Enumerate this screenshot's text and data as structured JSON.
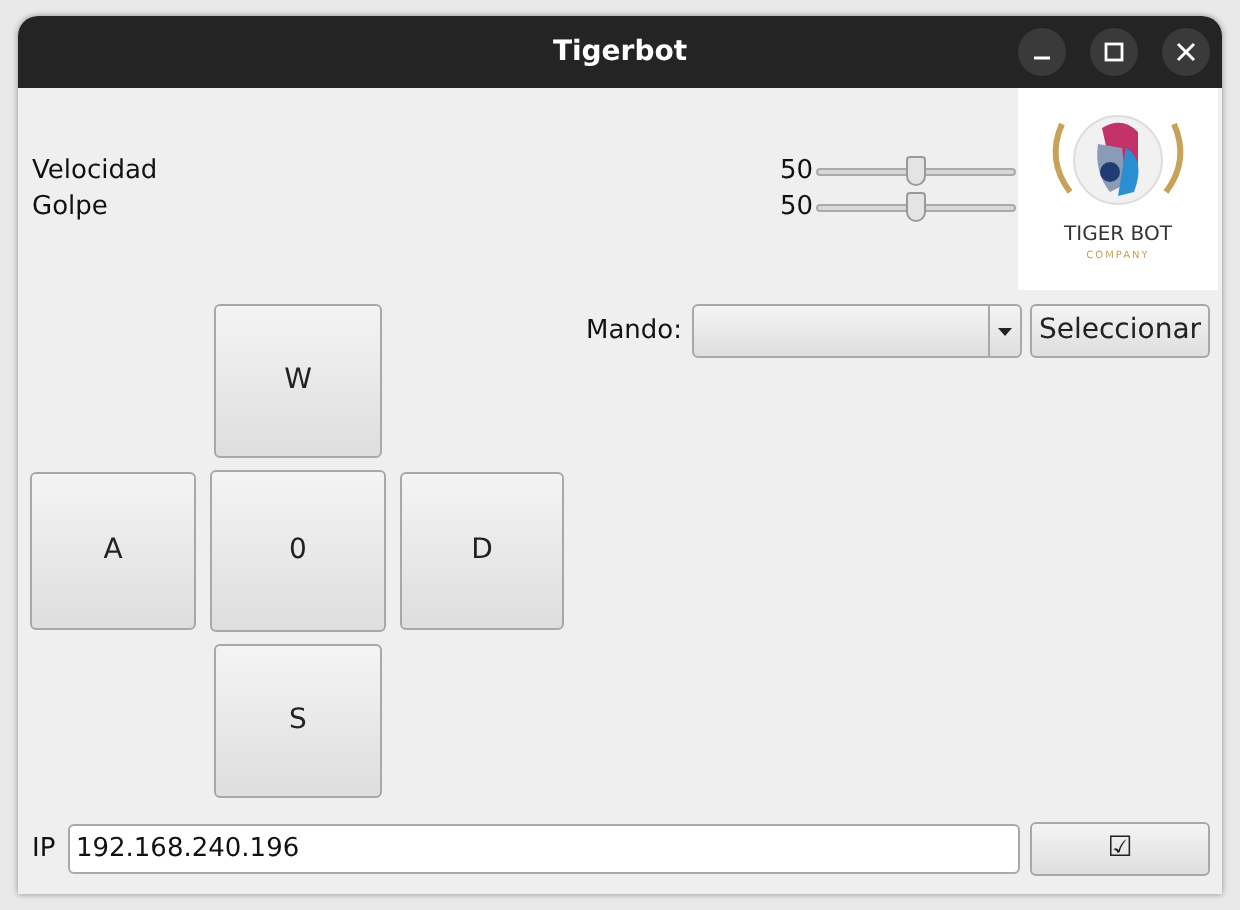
{
  "window": {
    "title": "Tigerbot"
  },
  "sliders": [
    {
      "label": "Velocidad",
      "value": "50",
      "level": 0.5
    },
    {
      "label": "Golpe",
      "value": "50",
      "level": 0.5
    }
  ],
  "logo": {
    "title": "TIGER BOT",
    "subtitle": "COMPANY"
  },
  "dpad": {
    "up": "W",
    "left": "A",
    "center": "0",
    "right": "D",
    "down": "S"
  },
  "controller": {
    "label": "Mando:",
    "button": "Seleccionar"
  },
  "ip": {
    "label": "IP",
    "value": "192.168.240.196",
    "button": "☑"
  }
}
